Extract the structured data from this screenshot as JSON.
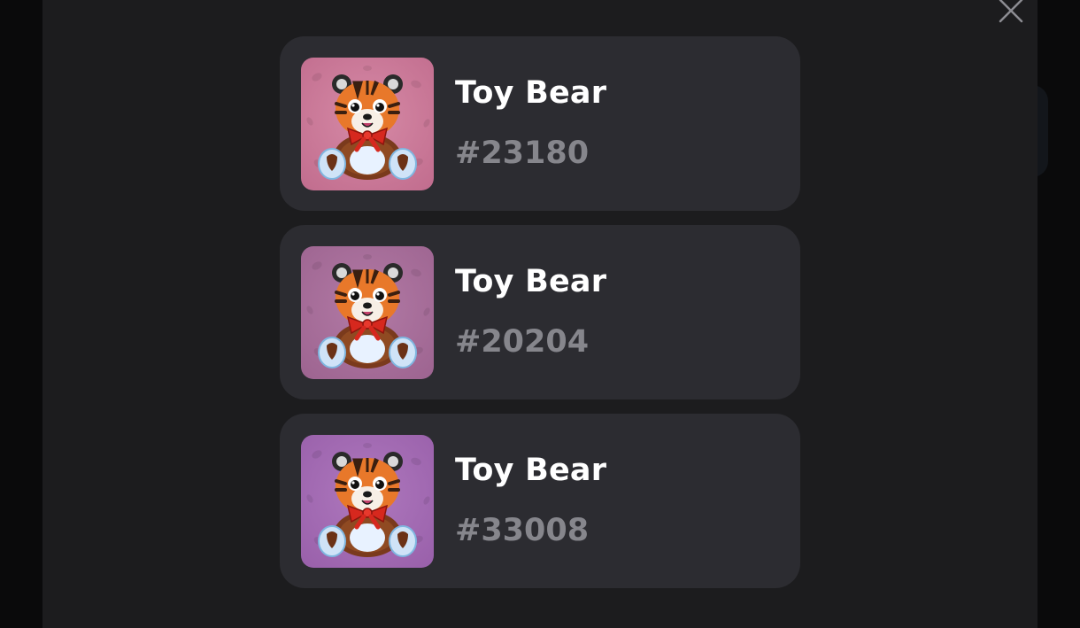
{
  "modal": {
    "close_icon": "close-icon"
  },
  "items": [
    {
      "name": "Toy Bear",
      "number": "#23180",
      "bg_color": "#c26e8f",
      "bg_light": "#d68aa6",
      "icon": "tiger-plush-icon"
    },
    {
      "name": "Toy Bear",
      "number": "#20204",
      "bg_color": "#9e6591",
      "bg_light": "#b27aa5",
      "icon": "tiger-plush-icon"
    },
    {
      "name": "Toy Bear",
      "number": "#33008",
      "bg_color": "#9a61ab",
      "bg_light": "#ae78bd",
      "icon": "tiger-plush-icon"
    }
  ]
}
